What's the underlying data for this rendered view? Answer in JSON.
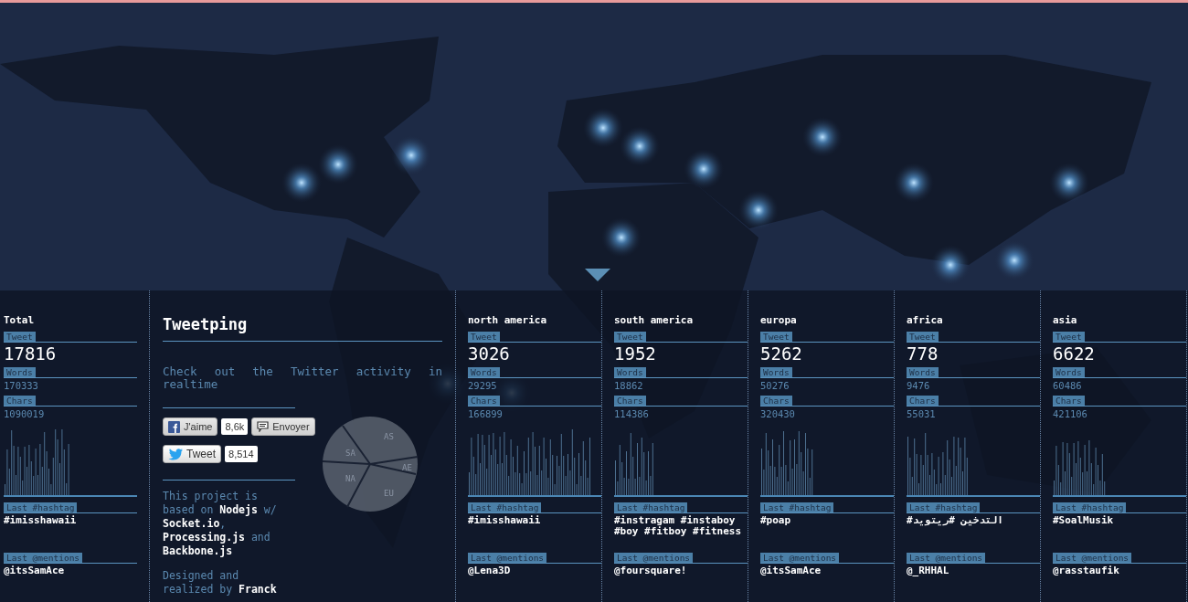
{
  "total": {
    "title": "Total",
    "tweet_label": "Tweet",
    "tweets": "17816",
    "words_label": "Words",
    "words": "170333",
    "chars_label": "Chars",
    "chars": "1090019",
    "hashtag_label": "Last #hashtag",
    "hashtag": "#imisshawaii",
    "mentions_label": "Last @mentions",
    "mention": "@itsSamAce"
  },
  "about": {
    "title": "Tweetping",
    "tagline": "Check out the Twitter activity in realtime",
    "like_label": "J'aime",
    "like_count": "8,6k",
    "send_label": "Envoyer",
    "tweet_label": "Tweet",
    "tweet_count": "8,514",
    "credits": "This project is based on **Nodejs** w/ **Socket.io**, **Processing.js** and **Backbone.js**",
    "designed": "Designed and realized by **Franck**",
    "pie_labels": [
      "AS",
      "SA",
      "NA",
      "AE",
      "EU"
    ]
  },
  "regions": [
    {
      "title": "north america",
      "tweet_label": "Tweet",
      "tweets": "3026",
      "words_label": "Words",
      "words": "29295",
      "chars_label": "Chars",
      "chars": "166899",
      "hashtag_label": "Last #hashtag",
      "hashtag": "#imisshawaii",
      "mentions_label": "Last @mentions",
      "mention": "@Lena3D"
    },
    {
      "title": "south america",
      "tweet_label": "Tweet",
      "tweets": "1952",
      "words_label": "Words",
      "words": "18862",
      "chars_label": "Chars",
      "chars": "114386",
      "hashtag_label": "Last #hashtag",
      "hashtag": "#instragam #instaboy #boy #fitboy #fitness",
      "mentions_label": "Last @mentions",
      "mention": "@foursquare!"
    },
    {
      "title": "europa",
      "tweet_label": "Tweet",
      "tweets": "5262",
      "words_label": "Words",
      "words": "50276",
      "chars_label": "Chars",
      "chars": "320430",
      "hashtag_label": "Last #hashtag",
      "hashtag": "#poap",
      "mentions_label": "Last @mentions",
      "mention": "@itsSamAce"
    },
    {
      "title": "africa",
      "tweet_label": "Tweet",
      "tweets": "778",
      "words_label": "Words",
      "words": "9476",
      "chars_label": "Chars",
      "chars": "55031",
      "hashtag_label": "Last #hashtag",
      "hashtag": "#التدخين #ريتويد",
      "mentions_label": "Last @mentions",
      "mention": "@_RHHAL"
    },
    {
      "title": "asia",
      "tweet_label": "Tweet",
      "tweets": "6622",
      "words_label": "Words",
      "words": "60486",
      "chars_label": "Chars",
      "chars": "421106",
      "hashtag_label": "Last #hashtag",
      "hashtag": "#SoalMusik",
      "mentions_label": "Last @mentions",
      "mention": "@rasstaufik"
    }
  ]
}
